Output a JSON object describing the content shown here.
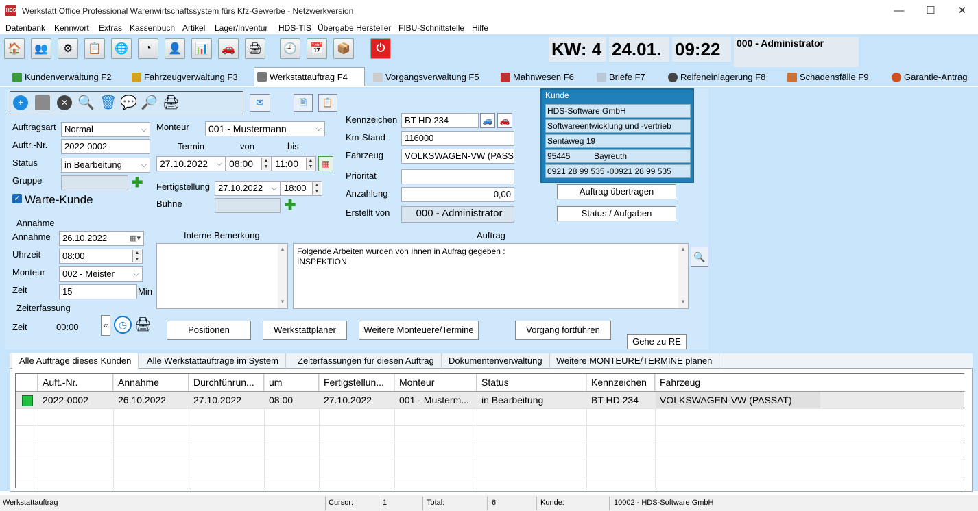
{
  "window": {
    "title": "Werkstatt Office Professional Warenwirtschaftssystem fürs Kfz-Gewerbe - Netzwerkversion",
    "app_icon": "HDS",
    "minimize": "—",
    "maximize": "☐",
    "close": "✕"
  },
  "menu": [
    "Datenbank",
    "Kennwort",
    "Extras",
    "Kassenbuch",
    "Artikel",
    "Lager/Inventur",
    "HDS-TIS",
    "Übergabe Hersteller",
    "FIBU-Schnittstelle",
    "Hilfe"
  ],
  "header": {
    "kw": "KW: 4",
    "date": "24.01.",
    "time": "09:22",
    "user": "000 - Administrator"
  },
  "tabs": [
    {
      "label": "Kundenverwaltung F2",
      "icon": "customer-icon"
    },
    {
      "label": "Fahrzeugverwaltung F3",
      "icon": "car-icon"
    },
    {
      "label": "Werkstattauftrag F4",
      "icon": "tools-icon"
    },
    {
      "label": "Vorgangsverwaltung F5",
      "icon": "document-icon"
    },
    {
      "label": "Mahnwesen F6",
      "icon": "warning-icon"
    },
    {
      "label": "Briefe F7",
      "icon": "letter-icon"
    },
    {
      "label": "Reifeneinlagerung F8",
      "icon": "tire-icon"
    },
    {
      "label": "Schadensfälle F9",
      "icon": "damage-icon"
    },
    {
      "label": "Garantie-Antrag",
      "icon": "warranty-icon"
    }
  ],
  "form": {
    "auftragsart_label": "Auftragsart",
    "auftragsart": "Normal",
    "auftrnr_label": "Auftr.-Nr.",
    "auftrnr": "2022-0002",
    "status_label": "Status",
    "status": "in Bearbeitung",
    "gruppe_label": "Gruppe",
    "gruppe": "",
    "wartekunde_label": "Warte-Kunde",
    "monteur_label": "Monteur",
    "monteur": "001 - Mustermann",
    "termin_label": "Termin",
    "von_label": "von",
    "bis_label": "bis",
    "termin": "27.10.2022",
    "von": "08:00",
    "bis": "11:00",
    "fertig_label": "Fertigstellung",
    "fertig_date": "27.10.2022",
    "fertig_time": "18:00",
    "buehne_label": "Bühne",
    "buehne": "",
    "kennzeichen_label": "Kennzeichen",
    "kennzeichen": "BT HD 234",
    "kmstand_label": "Km-Stand",
    "kmstand": "116000",
    "fahrzeug_label": "Fahrzeug",
    "fahrzeug": "VOLKSWAGEN-VW (PASS",
    "prioritaet_label": "Priorität",
    "prioritaet": "",
    "anzahlung_label": "Anzahlung",
    "anzahlung": "0,00",
    "erstellt_label": "Erstellt von",
    "erstellt": "000 - Administrator",
    "annahme_section": "Annahme",
    "annahme_label": "Annahme",
    "annahme": "26.10.2022",
    "uhrzeit_label": "Uhrzeit",
    "uhrzeit": "08:00",
    "monteur2_label": "Monteur",
    "monteur2": "002 - Meister",
    "zeit_label": "Zeit",
    "zeit": "15",
    "min_label": "Min",
    "zeiterfassung_section": "Zeiterfassung",
    "zeit2_label": "Zeit",
    "zeit2": "00:00",
    "interne_label": "Interne Bemerkung",
    "interne": "",
    "auftrag_label": "Auftrag",
    "auftrag_line1": "Folgende Arbeiten wurden von Ihnen in Aufrag gegeben :",
    "auftrag_line2": "INSPEKTION"
  },
  "kunde": {
    "title": "Kunde",
    "name": "HDS-Software GmbH",
    "line2": "Softwareentwicklung und -vertrieb",
    "street": "Sentaweg 19",
    "plz": "95445",
    "city": "Bayreuth",
    "phone": "0921 28 99 535 -00921 28 99 535"
  },
  "buttons": {
    "auftrag_uebertragen": "Auftrag übertragen",
    "status_aufgaben": "Status / Aufgaben",
    "positionen": "Positionen",
    "werkstattplaner": "Werkstattplaner",
    "weitere_monteure": "Weitere Monteuere/Termine",
    "vorgang": "Vorgang fortführen",
    "gehe_re": "Gehe zu RE",
    "collapse": "«"
  },
  "subtabs": [
    "Alle Aufträge dieses Kunden",
    "Alle Werkstattaufträge im System",
    "Zeiterfassungen für diesen Auftrag",
    "Dokumentenverwaltung",
    "Weitere MONTEURE/TERMINE planen"
  ],
  "grid": {
    "columns": [
      "Auft.-Nr.",
      "Annahme",
      "Durchführun...",
      "um",
      "Fertigstellun...",
      "Monteur",
      "Status",
      "Kennzeichen",
      "Fahrzeug"
    ],
    "rows": [
      {
        "status_color": "#1fbf3f",
        "cells": [
          "2022-0002",
          "26.10.2022",
          "27.10.2022",
          "08:00",
          "27.10.2022",
          "001 - Musterm...",
          "in Bearbeitung",
          "BT HD 234",
          "VOLKSWAGEN-VW (PASSAT)"
        ]
      }
    ]
  },
  "statusbar": {
    "mode": "Werkstattauftrag",
    "cursor_label": "Cursor:",
    "cursor": "1",
    "total_label": "Total:",
    "total": "6",
    "kunde_label": "Kunde:",
    "kunde": "10002 - HDS-Software GmbH"
  }
}
